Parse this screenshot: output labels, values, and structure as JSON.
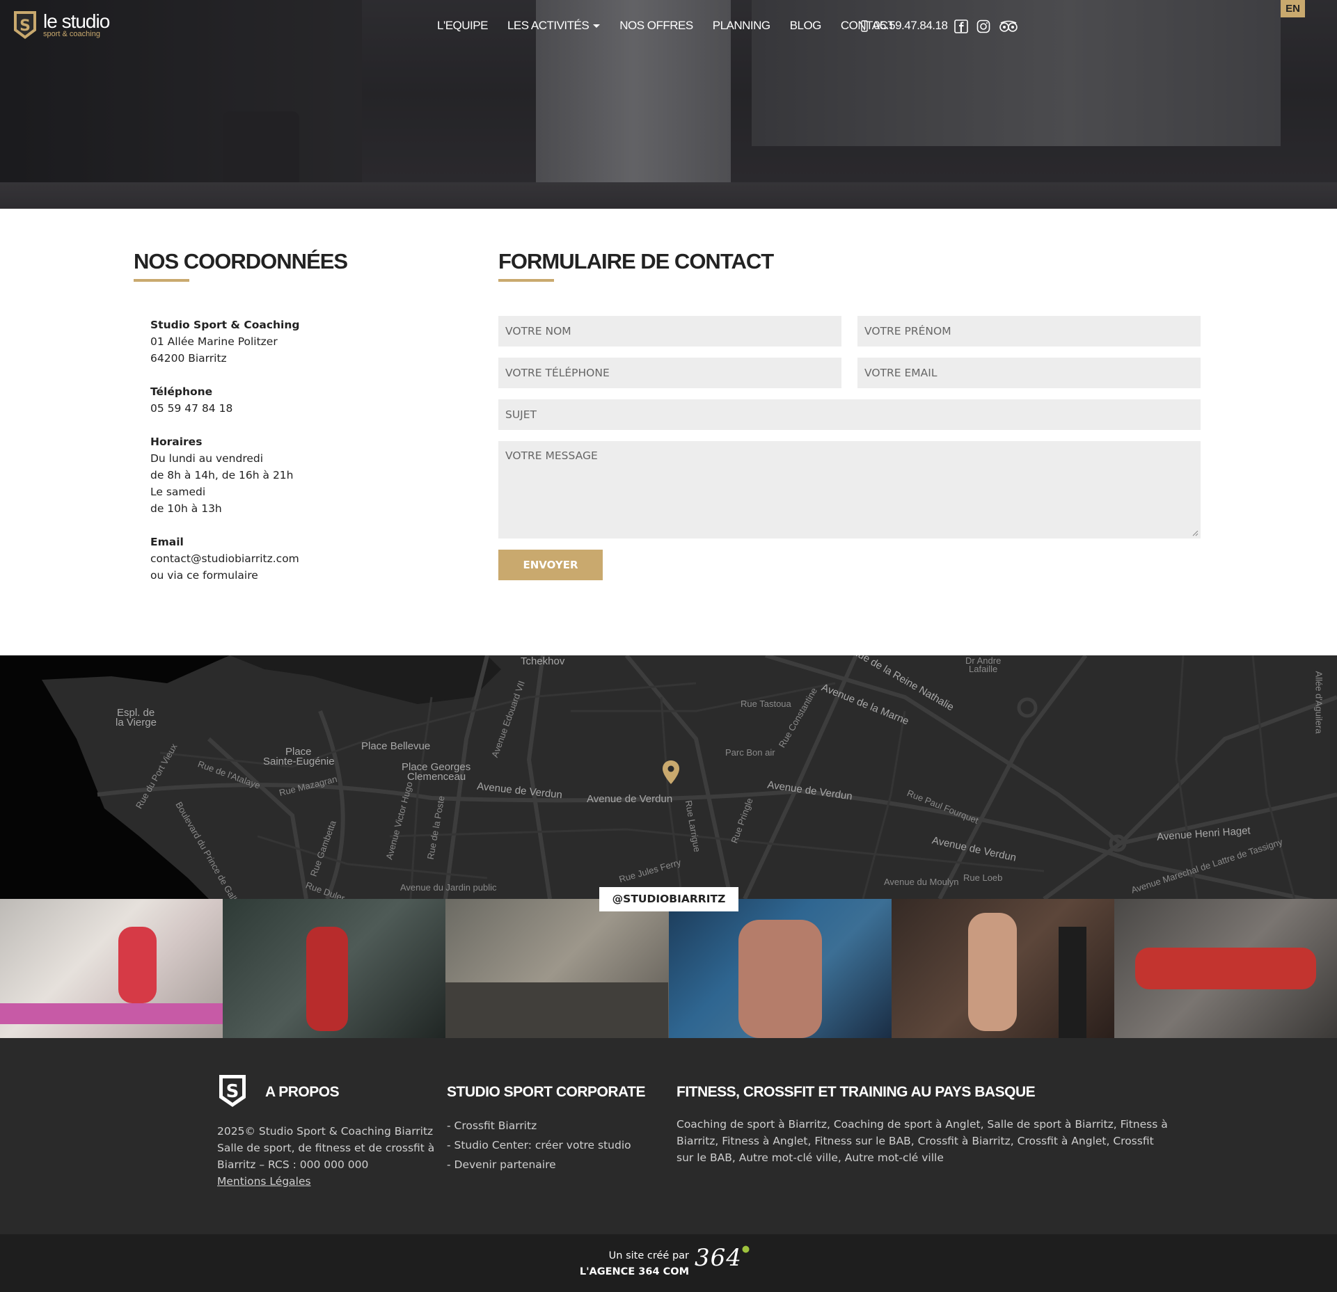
{
  "header": {
    "logo_title": "le studio",
    "logo_subtitle": "sport & coaching",
    "nav": [
      "L'EQUIPE",
      "LES ACTIVITÉS",
      "NOS OFFRES",
      "PLANNING",
      "BLOG",
      "CONTACT"
    ],
    "phone": "05.59.47.84.18",
    "social_icons": [
      "facebook-icon",
      "instagram-icon",
      "tripadvisor-icon"
    ],
    "lang": "EN"
  },
  "coords": {
    "title": "NOS COORDONNÉES",
    "company": "Studio Sport & Coaching",
    "address1": "01 Allée Marine Politzer",
    "address2": "64200 Biarritz",
    "phone_label": "Téléphone",
    "phone_value": "05 59 47 84 18",
    "hours_label": "Horaires",
    "hours1": "Du lundi au vendredi",
    "hours2": "de 8h à 14h, de 16h à 21h",
    "hours3": "Le samedi",
    "hours4": "de 10h à 13h",
    "email_label": "Email",
    "email_value": "contact@studiobiarritz.com",
    "email_note": "ou via ce formulaire"
  },
  "form": {
    "title": "FORMULAIRE DE CONTACT",
    "nom": "VOTRE NOM",
    "prenom": "VOTRE PRÉNOM",
    "telephone": "VOTRE TÉLÉPHONE",
    "email": "VOTRE EMAIL",
    "sujet": "SUJET",
    "message": "VOTRE MESSAGE",
    "submit": "ENVOYER"
  },
  "map": {
    "labels": [
      "Tchekhov",
      "Espl. de",
      "la Vierge",
      "Place",
      "Sainte-Eugénie",
      "Place Bellevue",
      "Place Georges",
      "Clemenceau",
      "Avenue de Verdun",
      "Avenue de Verdun",
      "Avenue de Verdun",
      "Avenue de Verdun",
      "Avenue de la Marne",
      "Avenue de la Reine Nathalie",
      "Dr Andre",
      "Lafaille",
      "Avenue Henri Haget",
      "Avenue Marechal de Lattre de Tassigny",
      "Allée d'Aguilera",
      "Rue Gambetta",
      "Avenue Victor Hugo",
      "Rue Pringle",
      "Avenue Edouard VII",
      "Rue Constantine",
      "Rue Jules Ferry",
      "Rue Loeb",
      "Avenue du Moulyn",
      "Avenue du Jardin public",
      "Rue Tastoua",
      "Parc Bon air",
      "Rue Paul Fourquet",
      "Rue du Port Vieux",
      "Rue de l'Atalaye",
      "Rue Mazagran",
      "Rue Duler",
      "Rue de la Poste",
      "Boulevard du Prince de Galles",
      "Rue Larrigue"
    ]
  },
  "instagram": {
    "tag": "@STUDIOBIARRITZ"
  },
  "footer": {
    "about_title": "A PROPOS",
    "about_line1": "2025© Studio Sport & Coaching Biarritz",
    "about_line2": "Salle de sport, de fitness et de crossfit à",
    "about_line3": "Biarritz – RCS : 000 000 000",
    "about_legal": "Mentions Légales",
    "corp_title": "STUDIO SPORT CORPORATE",
    "corp_links": [
      "- Crossfit Biarritz",
      "- Studio Center: créer votre studio",
      "- Devenir partenaire"
    ],
    "fit_title": "FITNESS, CROSSFIT ET TRAINING AU PAYS BASQUE",
    "fit_line1": "Coaching de sport à Biarritz, Coaching de sport à Anglet, Salle de sport à Biarritz, Fitness à",
    "fit_line2": "Biarritz, Fitness à Anglet, Fitness sur le BAB, Crossfit à Biarritz, Crossfit à Anglet, Crossfit",
    "fit_line3": "sur le BAB, Autre mot-clé ville, Autre mot-clé ville"
  },
  "bottom": {
    "line1": "Un site créé par",
    "line2": "L'AGENCE 364 COM",
    "logo": "364"
  },
  "colors": {
    "accent": "#c9a96e",
    "dark": "#2a2a2a",
    "darker": "#1e1e1e"
  }
}
